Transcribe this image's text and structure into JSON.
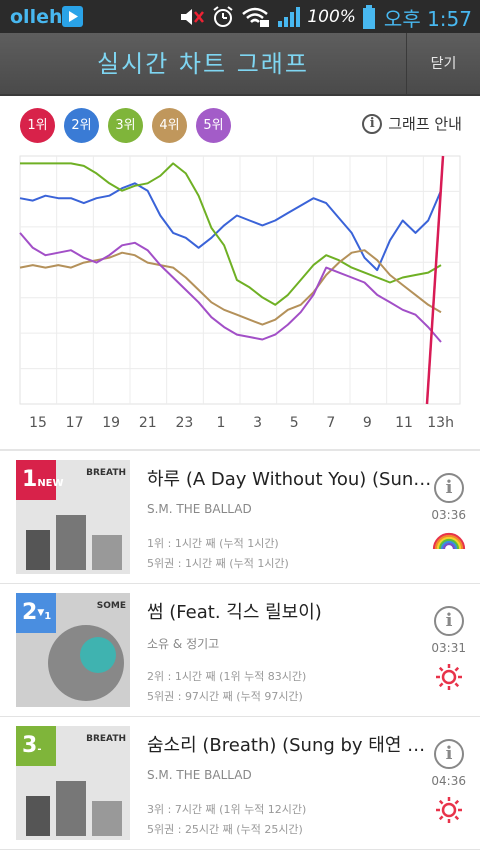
{
  "status_bar": {
    "carrier": "olleh",
    "battery": "100%",
    "time": "오후 1:57"
  },
  "header": {
    "title": "실시간 차트 그래프",
    "close_label": "닫기"
  },
  "rank_chips": [
    {
      "label": "1위",
      "color": "#d8224a"
    },
    {
      "label": "2위",
      "color": "#3a7bd5"
    },
    {
      "label": "3위",
      "color": "#7fb53a"
    },
    {
      "label": "4위",
      "color": "#c0975c"
    },
    {
      "label": "5위",
      "color": "#a35cc8"
    }
  ],
  "guide_label": "그래프 안내",
  "chart_data": {
    "type": "line",
    "x": [
      "15",
      "17",
      "19",
      "21",
      "23",
      "1",
      "3",
      "5",
      "7",
      "9",
      "11",
      "13h"
    ],
    "ylim": [
      0,
      100
    ],
    "grid": true,
    "current_time_marker": "13h",
    "series": [
      {
        "color": "#3a63d8",
        "values": [
          83,
          82,
          84,
          83,
          83,
          81,
          83,
          84,
          87,
          89,
          86,
          76,
          69,
          67,
          63,
          67,
          72,
          76,
          74,
          72,
          74,
          77,
          80,
          83,
          81,
          75,
          69,
          59,
          54,
          66,
          74,
          69,
          74,
          86
        ]
      },
      {
        "color": "#6fb024",
        "values": [
          97,
          97,
          97,
          97,
          97,
          96,
          93,
          89,
          86,
          88,
          89,
          92,
          97,
          93,
          84,
          71,
          64,
          50,
          47,
          43,
          40,
          44,
          50,
          56,
          60,
          58,
          55,
          53,
          51,
          49,
          51,
          52,
          53,
          56
        ]
      },
      {
        "color": "#b4915a",
        "values": [
          55,
          56,
          55,
          56,
          55,
          57,
          58,
          59,
          61,
          60,
          57,
          56,
          55,
          51,
          46,
          41,
          38,
          36,
          34,
          32,
          34,
          38,
          40,
          45,
          52,
          57,
          61,
          62,
          58,
          52,
          48,
          44,
          40,
          37
        ]
      },
      {
        "color": "#a24fc7",
        "values": [
          69,
          63,
          60,
          61,
          62,
          59,
          57,
          60,
          64,
          65,
          62,
          56,
          51,
          46,
          41,
          35,
          31,
          28,
          27,
          26,
          28,
          32,
          37,
          44,
          55,
          53,
          51,
          49,
          44,
          41,
          38,
          36,
          31,
          25
        ]
      }
    ]
  },
  "songs": [
    {
      "rank": "1",
      "change": "NEW",
      "rank_color": "#d8224a",
      "cover_label": "BREATH",
      "title": "하루 (A Day Without You) (Sung by 규현)",
      "artist": "S.M. THE BALLAD",
      "stat1": "1위 : 1시간 째 (누적 1시간)",
      "stat2": "5위권 : 1시간 째 (누적 1시간)",
      "duration": "03:36",
      "weather_icon": "rainbow-icon"
    },
    {
      "rank": "2",
      "change": "1",
      "rank_color": "#4a8ee0",
      "cover_label": "SOME",
      "title": "썸 (Feat. 긱스 릴보이)",
      "artist": "소유 & 정기고",
      "stat1": "2위 : 1시간 째 (1위 누적 83시간)",
      "stat2": "5위권 : 97시간 째 (누적 97시간)",
      "duration": "03:31",
      "weather_icon": "sun-icon"
    },
    {
      "rank": "3",
      "change": "-",
      "rank_color": "#7fb53a",
      "cover_label": "BREATH",
      "title": "숨소리 (Breath) (Sung by 태연 & 종현)",
      "artist": "S.M. THE BALLAD",
      "stat1": "3위 : 7시간 째 (1위 누적 12시간)",
      "stat2": "5위권 : 25시간 째 (누적 25시간)",
      "duration": "04:36",
      "weather_icon": "sun-icon"
    }
  ]
}
